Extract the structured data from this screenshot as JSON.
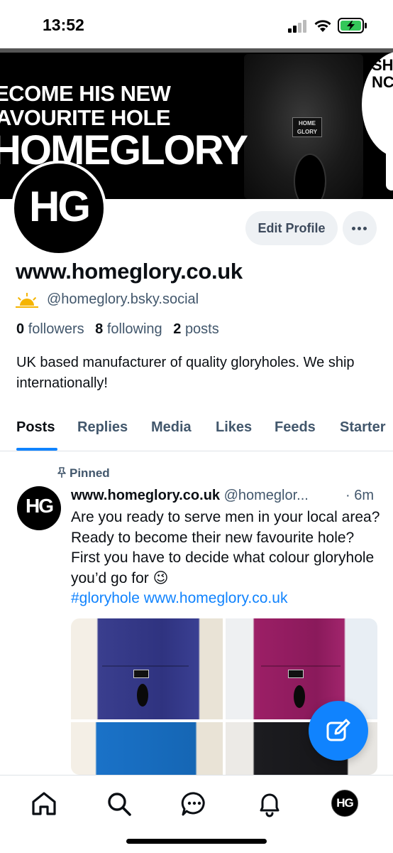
{
  "status_bar": {
    "time": "13:52"
  },
  "banner": {
    "line1": "ECOME HIS NEW",
    "line2": "AVOURITE HOLE",
    "brand": "HOMEGLORY",
    "box_label": "HOME GLORY",
    "speech_text": "SH NC"
  },
  "profile": {
    "avatar_initials": "HG",
    "edit_label": "Edit Profile",
    "display_name": "www.homeglory.co.uk",
    "handle": "@homeglory.bsky.social",
    "followers_count": "0",
    "followers_label": "followers",
    "following_count": "8",
    "following_label": "following",
    "posts_count": "2",
    "posts_label": "posts",
    "bio": "UK based manufacturer of quality gloryholes. We ship internationally!"
  },
  "tabs": [
    "Posts",
    "Replies",
    "Media",
    "Likes",
    "Feeds",
    "Starter"
  ],
  "active_tab": "Posts",
  "post": {
    "pinned_label": "Pinned",
    "avatar_initials": "HG",
    "author": "www.homeglory.co.uk",
    "handle": "@homeglor...",
    "time": "· 6m",
    "text": "Are you ready to serve men in your local area? Ready to become their new favourite hole? First you have to decide what colour gloryhole you’d go for 😉",
    "hashtag": "#gloryhole",
    "link": "www.homeglory.co.uk"
  },
  "nav": {
    "avatar_initials": "HG"
  },
  "colors": {
    "accent": "#1083fe",
    "muted_text": "#42576c",
    "button_bg": "#eef1f4"
  }
}
